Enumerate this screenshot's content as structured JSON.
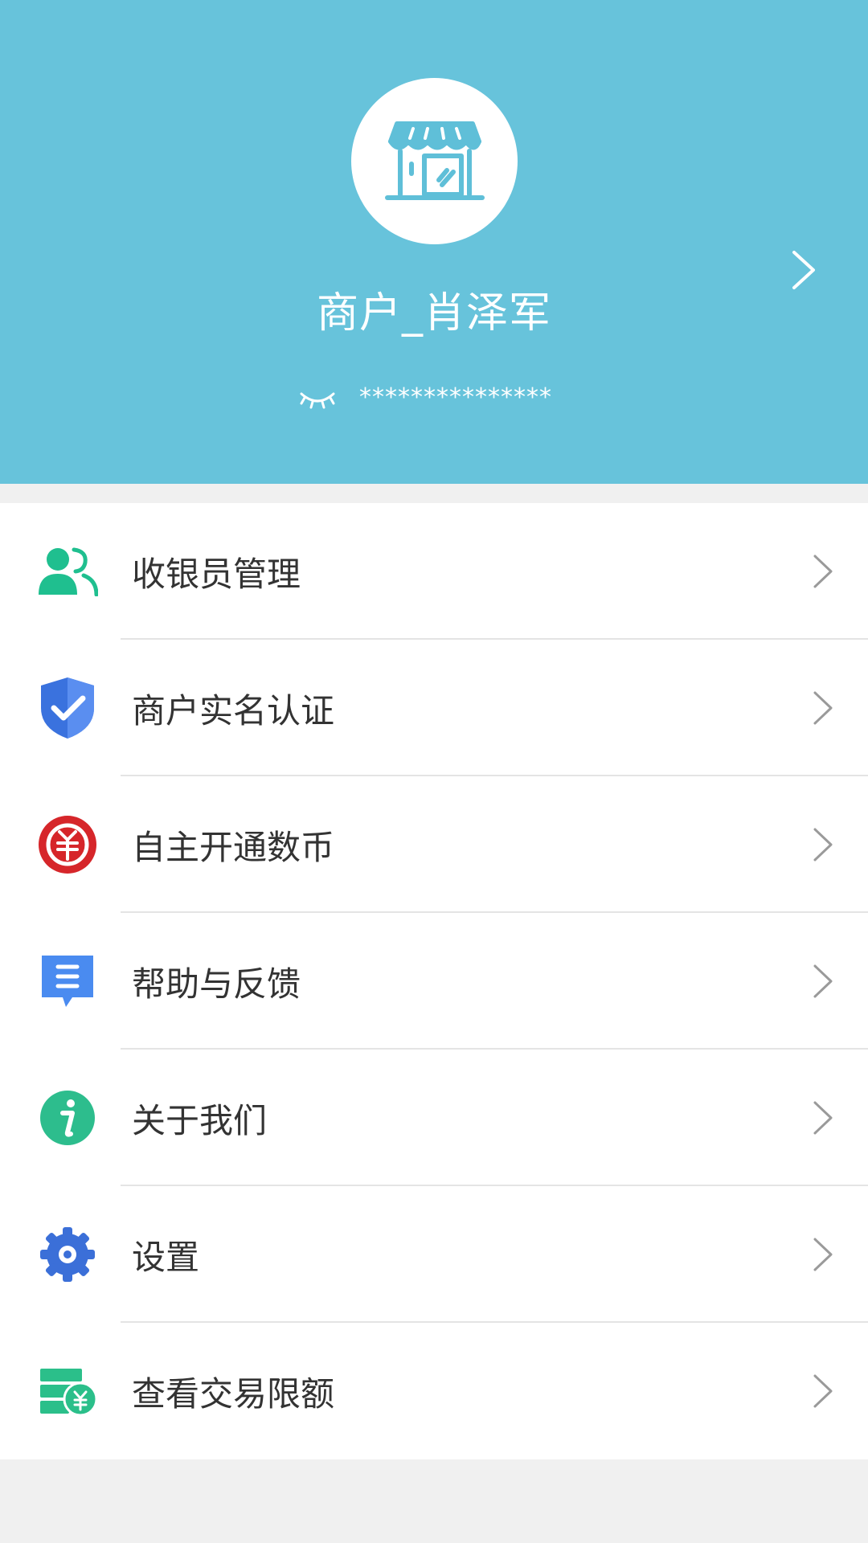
{
  "profile": {
    "merchant_name": "商户_肖泽军",
    "masked_account": "***************",
    "avatar_icon": "store-icon",
    "visibility_icon": "eye-closed-icon"
  },
  "menu": {
    "items": [
      {
        "label": "收银员管理",
        "icon": "cashier-users-icon",
        "color": "#1fbf8f"
      },
      {
        "label": "商户实名认证",
        "icon": "shield-check-icon",
        "color": "#3a72de"
      },
      {
        "label": "自主开通数币",
        "icon": "digital-yuan-icon",
        "color": "#d6262a"
      },
      {
        "label": "帮助与反馈",
        "icon": "feedback-icon",
        "color": "#4a8bf0"
      },
      {
        "label": "关于我们",
        "icon": "info-icon",
        "color": "#2dbd8d"
      },
      {
        "label": "设置",
        "icon": "gear-icon",
        "color": "#3b6fd8"
      },
      {
        "label": "查看交易限额",
        "icon": "transaction-limit-icon",
        "color": "#2bbf8a"
      }
    ]
  },
  "colors": {
    "header_bg": "#67c3db",
    "page_bg": "#f0f0f0",
    "text": "#333333",
    "chevron": "#9a9a9a"
  }
}
